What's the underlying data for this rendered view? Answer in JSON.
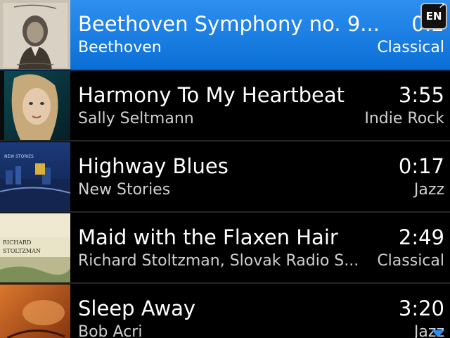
{
  "tracks": [
    {
      "title": "Beethoven Symphony no. 9...",
      "artist": "Beethoven",
      "duration": "0:2",
      "genre": "Classical",
      "selected": true,
      "album_art": "beethoven-portrait-album-art"
    },
    {
      "title": "Harmony To My Heartbeat",
      "artist": "Sally Seltmann",
      "duration": "3:55",
      "genre": "Indie Rock",
      "selected": false,
      "album_art": "sally-seltmann-portrait-album-art"
    },
    {
      "title": "Highway Blues",
      "artist": "New Stories",
      "duration": "0:17",
      "genre": "Jazz",
      "selected": false,
      "album_art": "new-stories-city-album-art"
    },
    {
      "title": "Maid with the Flaxen Hair",
      "artist": "Richard Stoltzman, Slovak Radio S...",
      "duration": "2:49",
      "genre": "Classical",
      "selected": false,
      "album_art": "richard-stoltzman-album-art",
      "album_art_text": "RICHARD STOLTZMAN"
    },
    {
      "title": "Sleep Away",
      "artist": "Bob Acri",
      "duration": "3:20",
      "genre": "Jazz",
      "selected": false,
      "album_art": "bob-acri-album-art"
    }
  ],
  "input_language": {
    "label": "EN",
    "icon": "expand-arrow-icon",
    "arrow_glyph": "↗"
  },
  "scroll_indicator": {
    "icon": "scroll-down-arrow-icon"
  },
  "colors": {
    "background": "#000000",
    "selection": "#1a7fe6",
    "primary_text": "#ffffff",
    "secondary_text": "#cfcfcf",
    "divider": "#262626"
  }
}
